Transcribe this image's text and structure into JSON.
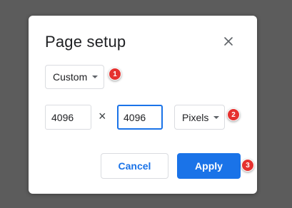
{
  "dialog": {
    "title": "Page setup",
    "close_icon": "close-icon"
  },
  "size_preset": {
    "selected": "Custom",
    "caret_icon": "caret-down-icon"
  },
  "dimensions": {
    "width_value": "4096",
    "separator": "×",
    "height_value": "4096"
  },
  "unit": {
    "selected": "Pixels",
    "caret_icon": "caret-down-icon"
  },
  "actions": {
    "cancel_label": "Cancel",
    "apply_label": "Apply"
  },
  "step_badges": [
    "1",
    "2",
    "3"
  ],
  "colors": {
    "backdrop": "#5c5c5c",
    "accent": "#1a73e8",
    "badge": "#e5312f"
  }
}
